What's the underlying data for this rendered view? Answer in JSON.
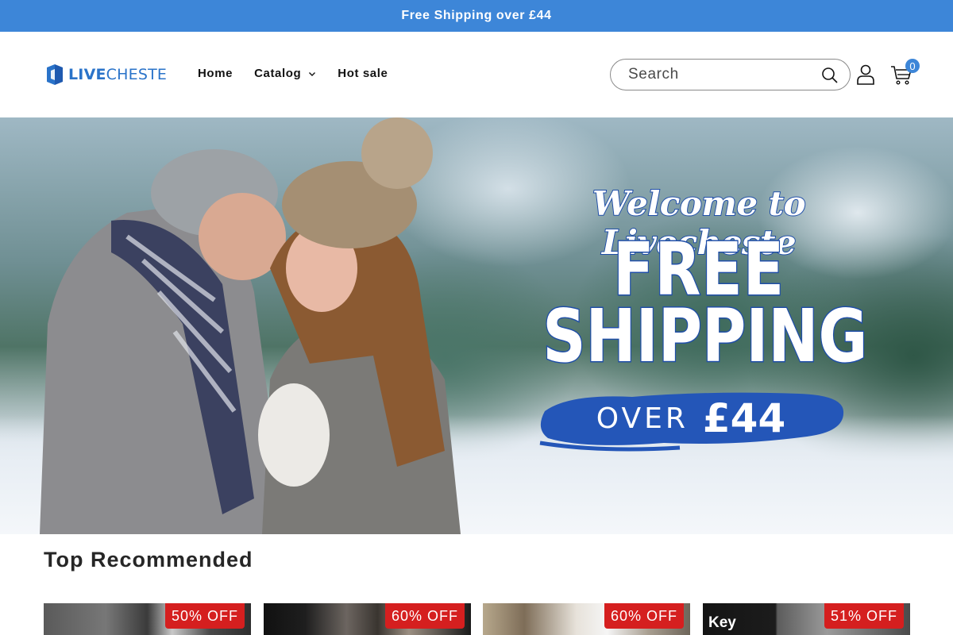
{
  "announcement": {
    "text": "Free Shipping over £44"
  },
  "header": {
    "logo": {
      "text_bold": "LIVE",
      "text_rest": "CHESTE"
    },
    "nav": [
      {
        "label": "Home"
      },
      {
        "label": "Catalog"
      },
      {
        "label": "Hot sale"
      }
    ],
    "search": {
      "placeholder": "Search"
    },
    "cart": {
      "count": "0"
    }
  },
  "hero": {
    "welcome": "Welcome to Livecheste",
    "line1": "FREE",
    "line2": "SHIPPING",
    "over_word": "OVER",
    "over_price": "£44",
    "colors": {
      "brand_blue": "#1f4ea8",
      "brush_blue": "#2456b8"
    }
  },
  "section": {
    "title": "Top Recommended",
    "products": [
      {
        "discount": "50% OFF"
      },
      {
        "discount": "60% OFF"
      },
      {
        "discount": "60% OFF"
      },
      {
        "discount": "51% OFF",
        "image_text": "Key"
      }
    ]
  },
  "colors": {
    "accent": "#3d86d8",
    "sale_badge": "#d51f1f"
  }
}
